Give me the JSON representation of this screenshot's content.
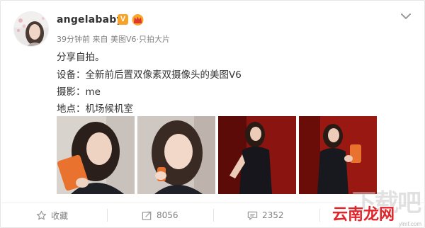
{
  "post": {
    "username": "angelababy",
    "verified_badge": "V",
    "time": "39分钟前",
    "source": "来自 美图V6·只拍大片",
    "lines": [
      "分享自拍。",
      "设备：全新前后置双像素双摄像头的美图V6",
      "摄影：me",
      "地点：机场候机室"
    ]
  },
  "photos": [
    {
      "name": "selfie-with-orange-phone"
    },
    {
      "name": "selfie-closeup"
    },
    {
      "name": "pose-red-background"
    },
    {
      "name": "holding-orange-phone-red-background"
    }
  ],
  "actions": {
    "favorite_label": "收藏",
    "repost_count": "8056",
    "comment_count": "2352"
  },
  "colors": {
    "verified": "#f7a229",
    "watermark_red": "#e1232a",
    "meta_gray": "#808080"
  },
  "icons": [
    "star-icon",
    "repost-icon",
    "comment-icon",
    "chevron-down-icon",
    "crown-icon"
  ],
  "watermark": {
    "text": "云南龙网",
    "url": "ylmf.com"
  }
}
